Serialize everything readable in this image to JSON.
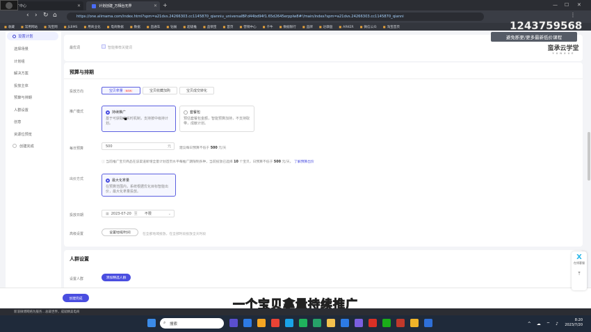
{
  "browser": {
    "tabs": [
      {
        "label": "推广中心",
        "active": false
      },
      {
        "label": "计划创建_万相台无界",
        "active": true
      }
    ],
    "url": "https://one.alimama.com/index.html?spm=a21dvs.24266303.cc1145870_qianniu_universalBP.d44bd94f1.65d2645erpplw8#!/main/index?spm=a21dvs.24266303.cc1145870_qianni",
    "bookmarks": [
      "收藏",
      "常用网站",
      "淘宝网",
      "JLBMS",
      "用商业化",
      "电商数据",
      "数据",
      "直通车",
      "钻展",
      "超级推",
      "品销宝",
      "首页",
      "营销中心",
      "千牛",
      "数据银行",
      "品牌",
      "达摩盘",
      "ARKER",
      "微信公众",
      "淘宝首页",
      "指数",
      "万相台"
    ]
  },
  "sidebar": {
    "active": "设置计划",
    "items": [
      "选择场景",
      "计划组",
      "解决方案",
      "投放主体",
      "预算与排期",
      "人群设置",
      "创意",
      "资源位预览",
      "创建完成"
    ]
  },
  "card1": {
    "label": "最优词",
    "value": "智能推荐关键词"
  },
  "budget_section": {
    "title": "预算与排期",
    "scene_label": "投放方向",
    "scene_options": [
      {
        "label": "宝贝拿量",
        "badge": "NEW",
        "selected": true
      },
      {
        "label": "宝贝收藏加购",
        "selected": false
      },
      {
        "label": "宝贝成交转化",
        "selected": false
      }
    ],
    "mode_label": "推广模式",
    "mode_options": [
      {
        "title": "持续推广",
        "desc": "基于可获取的实时机制，支持按中级持计划。",
        "selected": true
      },
      {
        "title": "套餐包",
        "desc": "预估套餐包金额，智能预算加持，不支持取带，成献计划。",
        "selected": false
      }
    ],
    "daily_budget_label": "每日预算",
    "daily_budget_value": "500",
    "daily_budget_unit": "元",
    "daily_budget_hint": "建议每日预算不低于",
    "daily_budget_min": "500",
    "daily_budget_min_unit": "元/天",
    "notice": "当前推广宝贝商品在该渠道新增全量计划首页水平每推广期限制多种，当前投放已选择",
    "notice_count": "10",
    "notice_mid": "个宝贝，日预算不低于",
    "notice_amount": "500",
    "notice_tail": "元/天，",
    "notice_link": "了解预算出价",
    "bid_label": "出价方式",
    "bid_option_title": "最大化拿量",
    "bid_option_desc": "在预算范围内，系统根据优化目标智能出价，最大化拿量投放。",
    "date_label": "投放日期",
    "date_value": "2023-07-20",
    "date_sep": "至",
    "date_end": "不限",
    "region_label": "高级设置",
    "region_button": "设置地域/时间",
    "region_hint": "在全部地域投放，在全部时段投放全天时段"
  },
  "crowd_section": {
    "title": "人群设置",
    "label": "设置人群",
    "button": "添加精选人群"
  },
  "footer": {
    "finish_button": "创建完成"
  },
  "overlays": {
    "watermark_number": "1243759568",
    "promo_text": "避免断更/更多最新低价课程",
    "logo_text": "蛮承云学堂",
    "logo_sub": "Y U N X U E",
    "subtitle": "一个宝贝拿量持续推广",
    "float_label": "在线客服"
  },
  "status_bar": {
    "text": "新浪微博网络为服务…总裁世界，成就精美电商"
  },
  "taskbar": {
    "search_placeholder": "搜索",
    "time": "8:20",
    "date": "2023/7/20"
  }
}
